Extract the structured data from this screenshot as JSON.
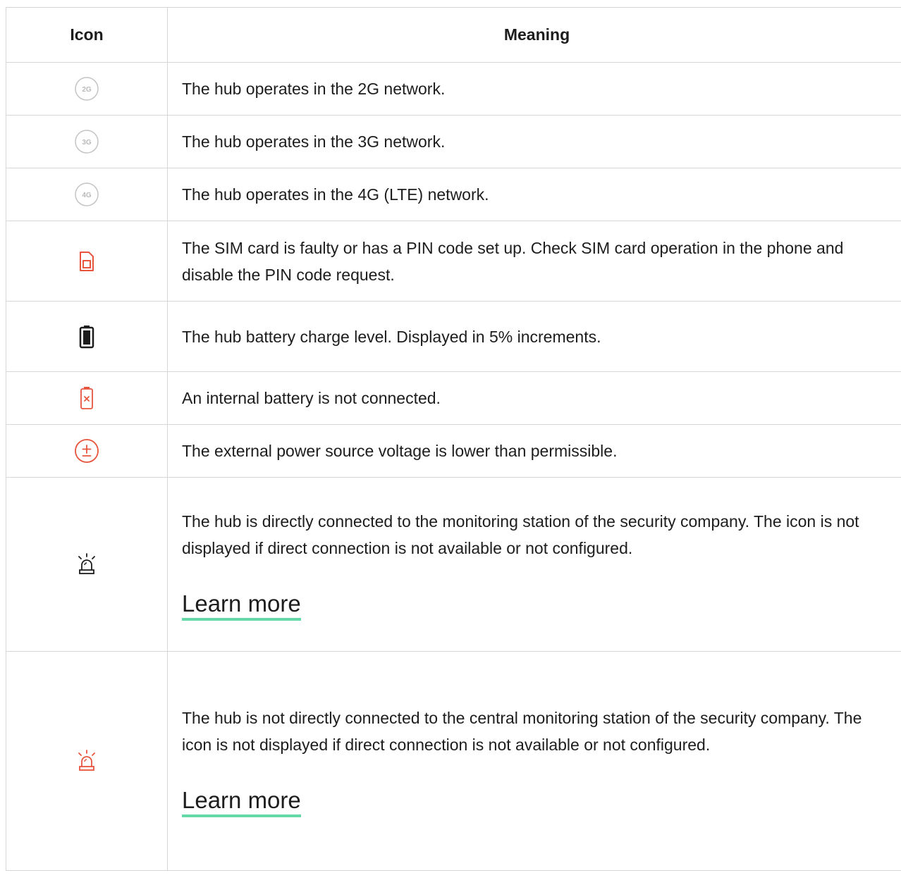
{
  "table": {
    "header": {
      "icon": "Icon",
      "meaning": "Meaning"
    },
    "rows": [
      {
        "icon": "network-2g-icon",
        "icon_label": "2G",
        "meaning": "The hub operates in the 2G network."
      },
      {
        "icon": "network-3g-icon",
        "icon_label": "3G",
        "meaning": "The hub operates in the 3G network."
      },
      {
        "icon": "network-4g-icon",
        "icon_label": "4G",
        "meaning": "The hub operates in the 4G (LTE) network."
      },
      {
        "icon": "sim-card-error-icon",
        "meaning": "The SIM card is faulty or has a PIN code set up. Check SIM card operation in the phone and disable the PIN code request."
      },
      {
        "icon": "battery-level-icon",
        "meaning": "The hub battery charge level. Displayed in 5% increments."
      },
      {
        "icon": "battery-disconnected-icon",
        "meaning": "An internal battery is not connected."
      },
      {
        "icon": "power-voltage-low-icon",
        "meaning": "The external power source voltage is lower than permissible."
      },
      {
        "icon": "siren-connected-icon",
        "meaning": "The hub is directly connected to the monitoring station of the security company. The icon is not displayed if direct connection is not available or not configured.",
        "link": "Learn more"
      },
      {
        "icon": "siren-disconnected-icon",
        "meaning": "The hub is not directly connected to the central monitoring station of the security company. The icon is not displayed if direct connection is not available or not configured.",
        "link": "Learn more"
      }
    ]
  },
  "colors": {
    "alert": "#e8553f",
    "muted_icon": "#b9b9b9",
    "link_underline": "#64d8a7",
    "border": "#d6d6d6"
  }
}
